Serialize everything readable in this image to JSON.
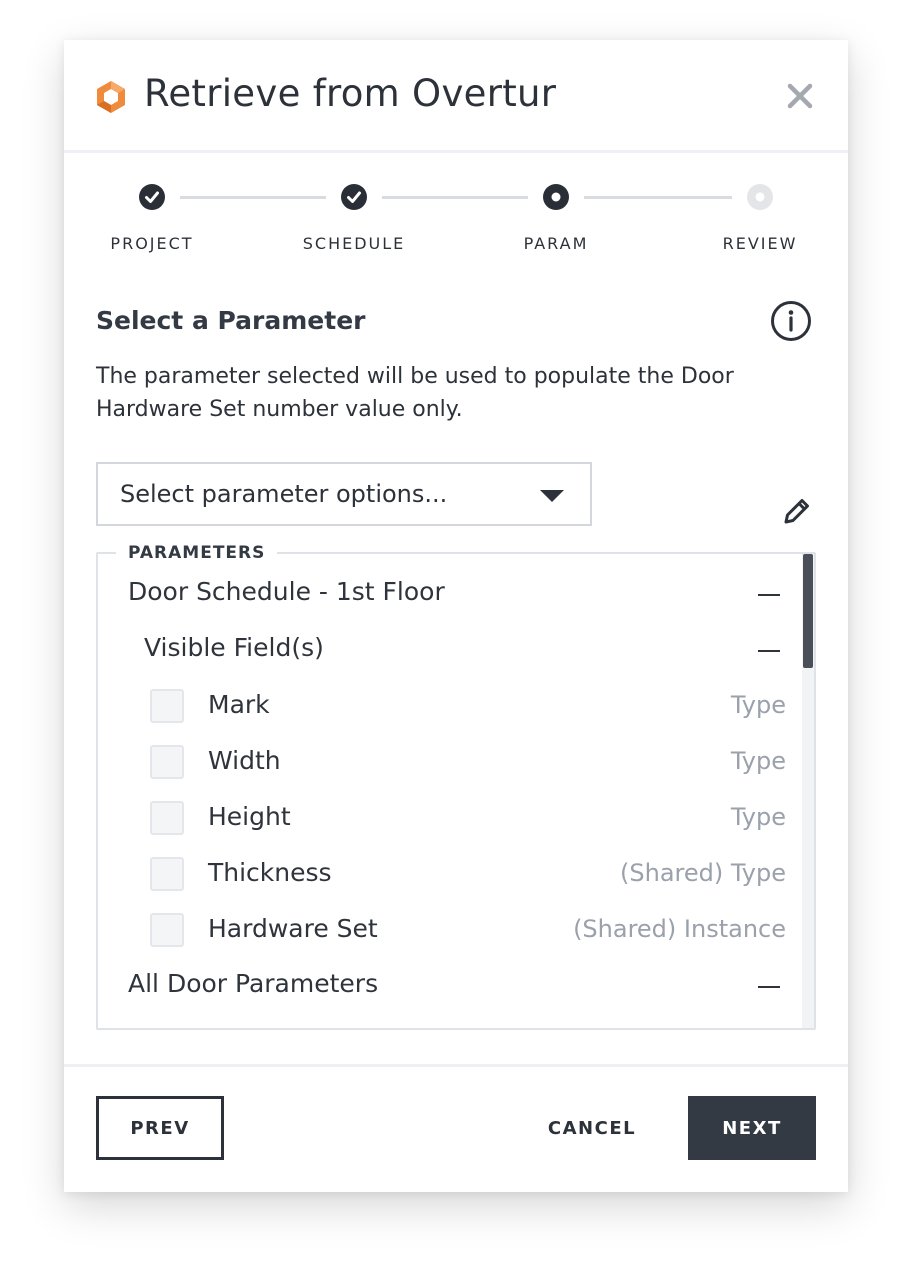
{
  "dialog": {
    "title": "Retrieve from Overtur",
    "close_icon": "close-icon",
    "brand_color": "#f08a3c"
  },
  "stepper": {
    "steps": [
      {
        "label": "PROJECT",
        "state": "complete"
      },
      {
        "label": "SCHEDULE",
        "state": "complete"
      },
      {
        "label": "PARAM",
        "state": "current"
      },
      {
        "label": "REVIEW",
        "state": "upcoming"
      }
    ]
  },
  "section": {
    "title": "Select a Parameter",
    "description": "The parameter selected will be used to populate the Door Hardware Set number value only."
  },
  "select": {
    "value": "Select parameter options..."
  },
  "parameters": {
    "legend": "PARAMETERS",
    "group": "Door Schedule - 1st Floor",
    "subgroup": "Visible Field(s)",
    "fields": [
      {
        "name": "Mark",
        "type": "Type",
        "checked": false
      },
      {
        "name": "Width",
        "type": "Type",
        "checked": false
      },
      {
        "name": "Height",
        "type": "Type",
        "checked": false
      },
      {
        "name": "Thickness",
        "type": "(Shared) Type",
        "checked": false
      },
      {
        "name": "Hardware Set",
        "type": "(Shared) Instance",
        "checked": false
      }
    ],
    "group2": "All Door Parameters"
  },
  "footer": {
    "prev_label": "PREV",
    "cancel_label": "CANCEL",
    "next_label": "NEXT"
  }
}
